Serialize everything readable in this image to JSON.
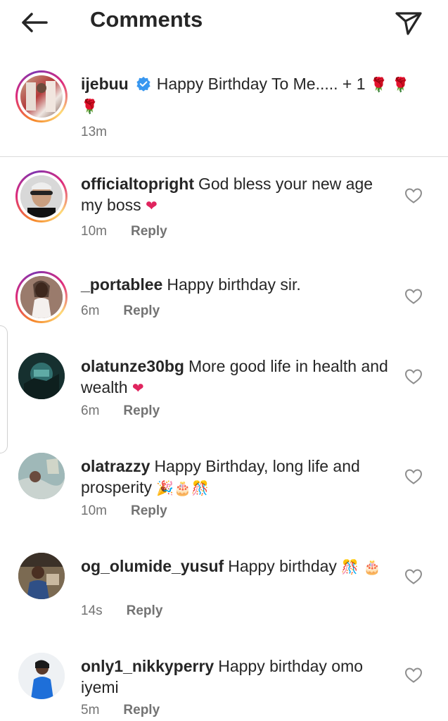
{
  "header": {
    "title": "Comments"
  },
  "caption": {
    "username": "ijebuu",
    "text": "Happy Birthday To Me..... + 1",
    "emoji": "🌹 🌹 🌹",
    "time": "13m"
  },
  "comments": [
    {
      "username": "officialtopright",
      "text": "God bless your new age my boss",
      "emoji": "❤",
      "time": "10m",
      "reply": "Reply"
    },
    {
      "username": "_portablee",
      "text": "Happy birthday sir.",
      "emoji": "",
      "time": "6m",
      "reply": "Reply"
    },
    {
      "username": "olatunze30bg",
      "text": "More good life in health and wealth",
      "emoji": "❤",
      "time": "6m",
      "reply": "Reply"
    },
    {
      "username": "olatrazzy",
      "text": "Happy Birthday, long life and prosperity",
      "emoji": "🎉🎂🎊",
      "time": "10m",
      "reply": "Reply"
    },
    {
      "username": "og_olumide_yusuf",
      "text": "Happy birthday",
      "emoji": "🎊 🎂",
      "time": "14s",
      "reply": "Reply"
    },
    {
      "username": "only1_nikkyperry",
      "text": "Happy birthday omo iyemi",
      "emoji": "",
      "time": "5m",
      "reply": "Reply"
    }
  ],
  "icons": {
    "back": "arrow-left-icon",
    "send": "paper-plane-icon",
    "verified": "verified-badge-icon",
    "like": "heart-outline-icon"
  },
  "colors": {
    "verified": "#3897f0",
    "heart": "#e0245e",
    "muted": "#737373"
  }
}
